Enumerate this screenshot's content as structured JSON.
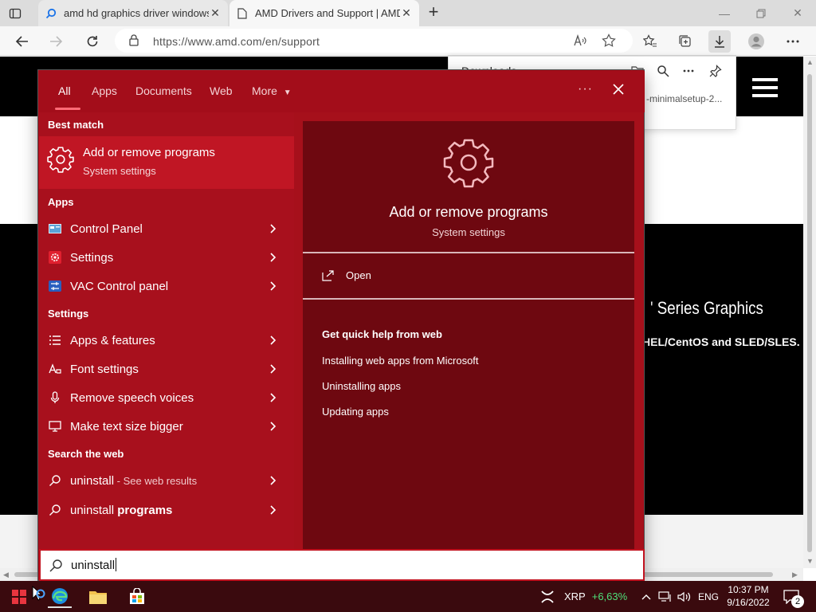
{
  "browser": {
    "tabs": [
      {
        "title": "amd hd graphics driver windows",
        "active": false
      },
      {
        "title": "AMD Drivers and Support | AMD",
        "active": true
      }
    ],
    "address": "https://www.amd.com/en/support",
    "downloads": {
      "title": "Downloads",
      "file": "-minimalsetup-2..."
    }
  },
  "page": {
    "heading": "' Series Graphics",
    "subheading": "HEL/CentOS and SLED/SLES."
  },
  "search": {
    "tabs": [
      "All",
      "Apps",
      "Documents",
      "Web",
      "More"
    ],
    "active_tab": "All",
    "more_arrow": "▼",
    "dots": "···",
    "best_match": {
      "header": "Best match",
      "title": "Add or remove programs",
      "subtitle": "System settings"
    },
    "apps": {
      "header": "Apps",
      "items": [
        {
          "label": "Control Panel",
          "icon": "control-panel-icon"
        },
        {
          "label": "Settings",
          "icon": "settings-icon"
        },
        {
          "label": "VAC Control panel",
          "icon": "vac-icon"
        }
      ]
    },
    "settings": {
      "header": "Settings",
      "items": [
        {
          "label": "Apps & features",
          "icon": "list-icon"
        },
        {
          "label": "Font settings",
          "icon": "font-icon"
        },
        {
          "label": "Remove speech voices",
          "icon": "microphone-icon"
        },
        {
          "label": "Make text size bigger",
          "icon": "monitor-icon"
        }
      ]
    },
    "web": {
      "header": "Search the web",
      "items": [
        {
          "term": "uninstall",
          "suffix": " - See web results"
        },
        {
          "term": "uninstall",
          "bold": "programs"
        }
      ]
    },
    "preview": {
      "title": "Add or remove programs",
      "subtitle": "System settings",
      "open_label": "Open",
      "help_header": "Get quick help from web",
      "help_links": [
        "Installing web apps from Microsoft",
        "Uninstalling apps",
        "Updating apps"
      ]
    },
    "query": "uninstall"
  },
  "taskbar": {
    "ticker": "XRP",
    "ticker_change": "+6,63%",
    "lang": "ENG",
    "time": "10:37 PM",
    "date": "9/16/2022",
    "notifications": "2"
  },
  "colors": {
    "panel": "#a6101b",
    "best_highlight": "#c01624",
    "preview_bg": "#6e0810",
    "ticker_green": "#4ee07a"
  }
}
